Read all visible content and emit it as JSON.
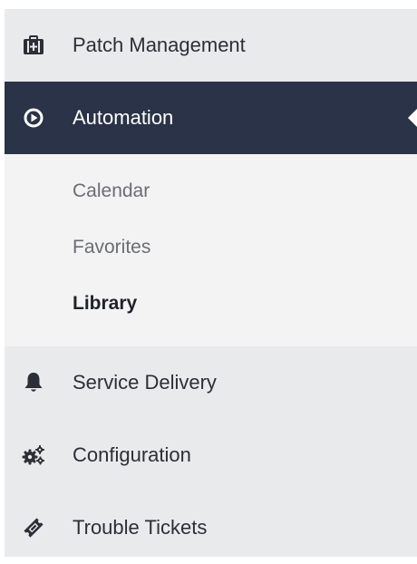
{
  "sidebar": {
    "items": [
      {
        "label": "Patch Management",
        "icon": "medical-kit-icon"
      },
      {
        "label": "Automation",
        "icon": "play-circle-icon",
        "active": true
      },
      {
        "label": "Service Delivery",
        "icon": "bell-icon"
      },
      {
        "label": "Configuration",
        "icon": "gears-icon"
      },
      {
        "label": "Trouble Tickets",
        "icon": "ticket-icon"
      }
    ],
    "submenu": [
      {
        "label": "Calendar"
      },
      {
        "label": "Favorites"
      },
      {
        "label": "Library",
        "selected": true
      }
    ]
  },
  "colors": {
    "sidebar_bg": "#e9eaec",
    "active_bg": "#2a3347",
    "submenu_bg": "#f3f3f4"
  }
}
